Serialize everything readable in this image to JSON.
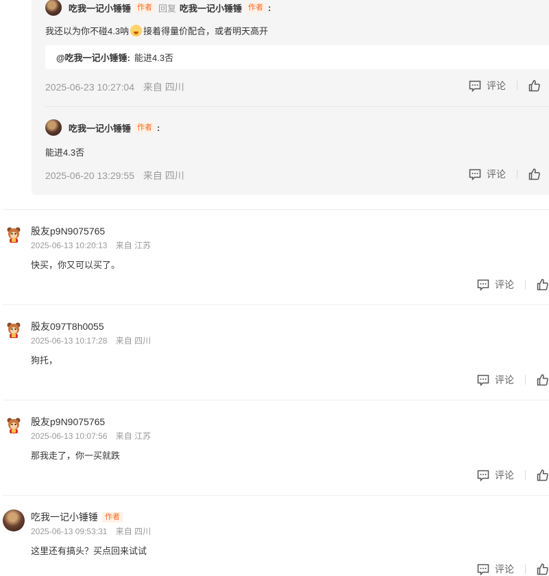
{
  "reply_thread": {
    "replies": [
      {
        "author": "吃我一记小锤锤",
        "author_tag": "作者",
        "reply_label": "回复",
        "reply_to": "吃我一记小锤锤",
        "reply_to_tag": "作者",
        "text_before_emoji": "我还以为你不碰4.3呐",
        "emoji": "laughing-emoji",
        "text_after_emoji": "接着得量价配合，或者明天高开",
        "quote_user": "@吃我一记小锤锤:",
        "quote_text": "能进4.3否",
        "datetime": "2025-06-23 10:27:04",
        "location": "来自 四川",
        "comment_label": "评论"
      },
      {
        "author": "吃我一记小锤锤",
        "author_tag": "作者",
        "text": "能进4.3否",
        "datetime": "2025-06-20 13:29:55",
        "location": "来自 四川",
        "comment_label": "评论"
      }
    ]
  },
  "comments": [
    {
      "user": "股友p9N9075765",
      "datetime": "2025-06-13 10:20:13",
      "location": "来自 江苏",
      "text": "快买，你又可以买了。",
      "comment_label": "评论"
    },
    {
      "user": "股友097T8h0055",
      "datetime": "2025-06-13 10:17:28",
      "location": "来自 四川",
      "text": "狗托，",
      "comment_label": "评论"
    },
    {
      "user": "股友p9N9075765",
      "datetime": "2025-06-13 10:07:56",
      "location": "来自 江苏",
      "text": "那我走了，你一买就跌",
      "comment_label": "评论"
    },
    {
      "user": "吃我一记小锤锤",
      "user_tag": "作者",
      "datetime": "2025-06-13 09:53:31",
      "location": "来自 四川",
      "text": "这里还有搞头？买点回来试试",
      "comment_label": "评论"
    }
  ],
  "colors": {
    "author_tag_text": "#ff6a1f",
    "author_tag_bg": "#fff1e8",
    "meta_text": "#999999",
    "reply_box_bg": "#f5f5f5"
  },
  "icons": {
    "comment": "comment-bubble-icon",
    "like": "thumbs-up-icon",
    "default_avatar": "red-mascot-avatar"
  }
}
